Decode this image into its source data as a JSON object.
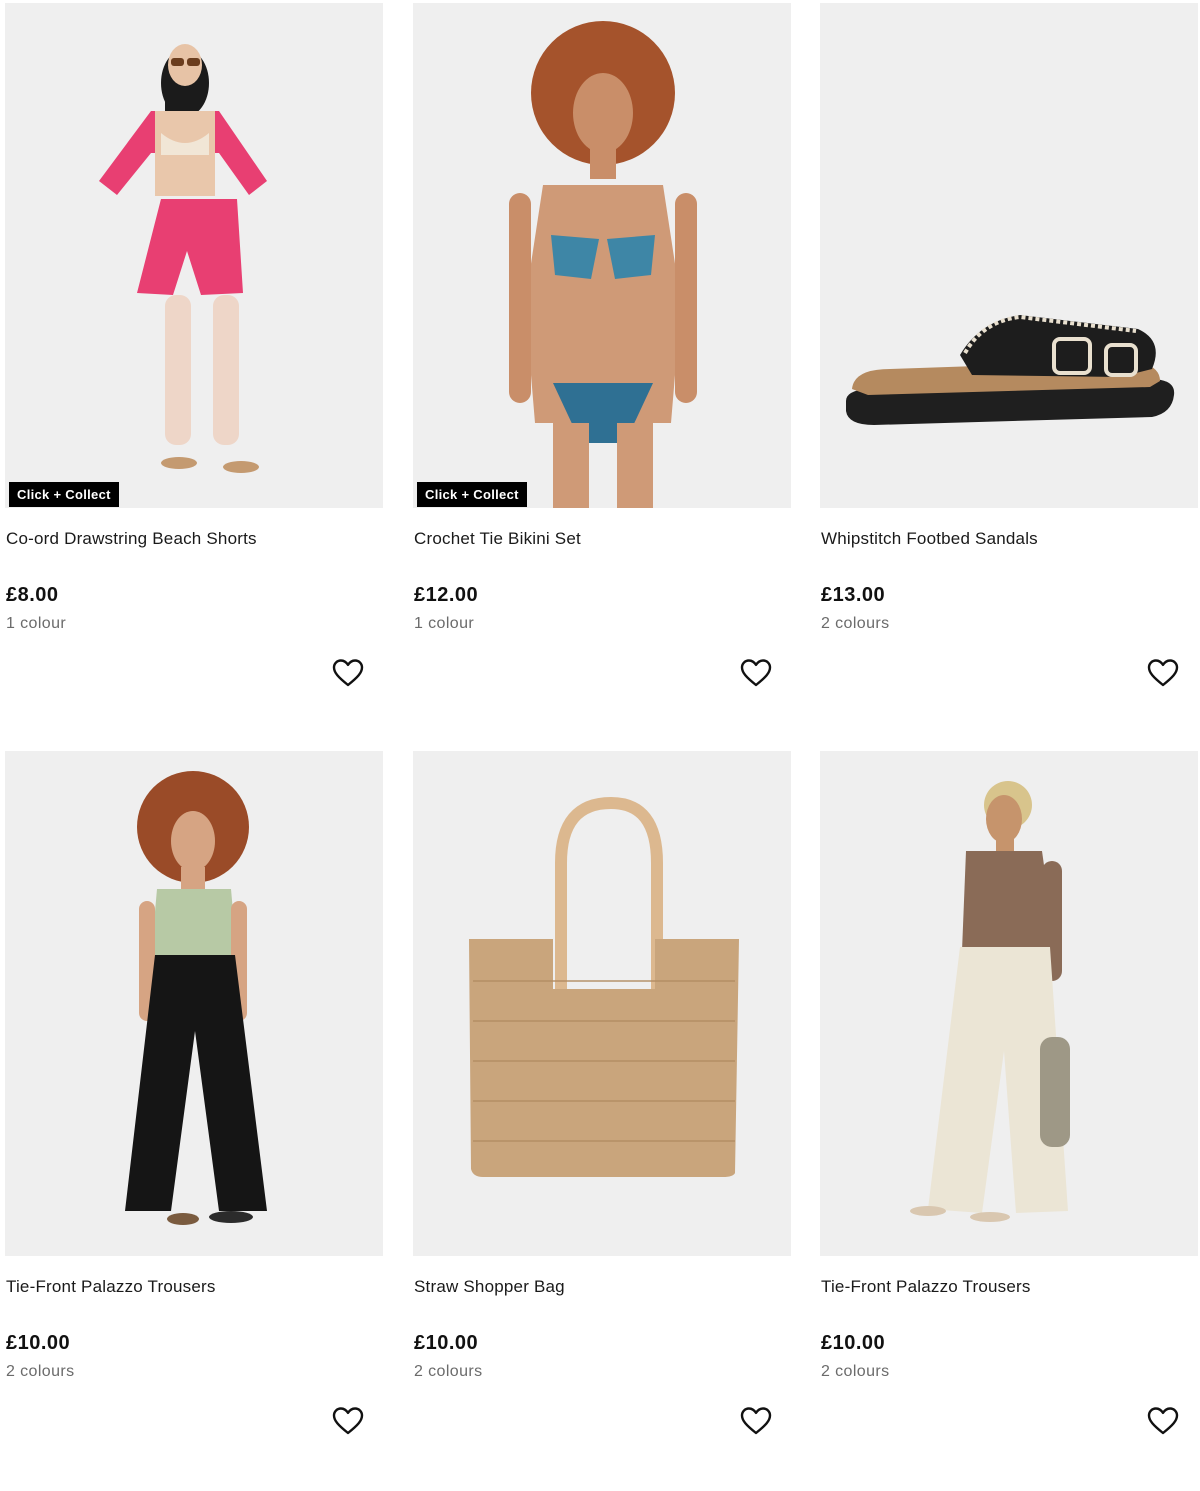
{
  "products": [
    {
      "title": "Co-ord Drawstring Beach Shorts",
      "price": "£8.00",
      "colours": "1 colour",
      "badge": "Click + Collect",
      "image_icon": "model-pink-beach-set-image"
    },
    {
      "title": "Crochet Tie Bikini Set",
      "price": "£12.00",
      "colours": "1 colour",
      "badge": "Click + Collect",
      "image_icon": "model-crochet-bikini-image"
    },
    {
      "title": "Whipstitch Footbed Sandals",
      "price": "£13.00",
      "colours": "2 colours",
      "badge": "",
      "image_icon": "black-footbed-sandal-image"
    },
    {
      "title": "Tie-Front Palazzo Trousers",
      "price": "£10.00",
      "colours": "2 colours",
      "badge": "",
      "image_icon": "model-black-palazzo-trousers-image"
    },
    {
      "title": "Straw Shopper Bag",
      "price": "£10.00",
      "colours": "2 colours",
      "badge": "",
      "image_icon": "straw-shopper-bag-image"
    },
    {
      "title": "Tie-Front Palazzo Trousers",
      "price": "£10.00",
      "colours": "2 colours",
      "badge": "",
      "image_icon": "model-cream-palazzo-trousers-image"
    }
  ],
  "colors": {
    "badge_bg": "#000000",
    "badge_text": "#ffffff",
    "image_bg": "#efefef",
    "price_text": "#111111",
    "colours_text": "#6b6b6b"
  },
  "icons": {
    "wishlist": "heart-outline-icon"
  }
}
